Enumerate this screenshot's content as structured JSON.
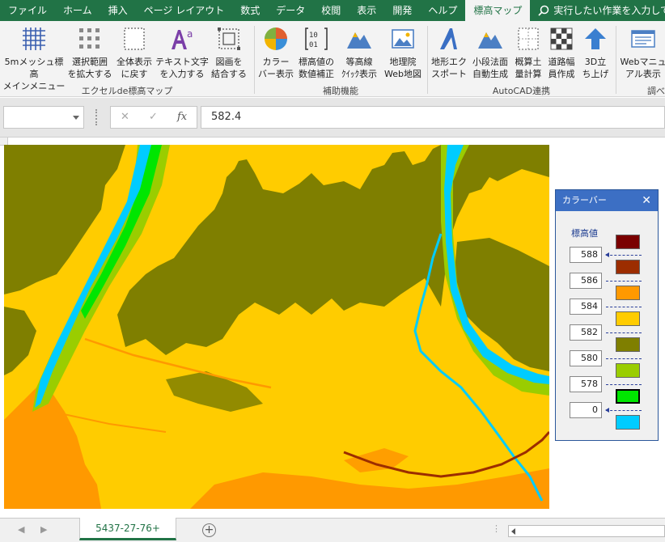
{
  "tabs": [
    "ファイル",
    "ホーム",
    "挿入",
    "ページ レイアウト",
    "数式",
    "データ",
    "校閲",
    "表示",
    "開発",
    "ヘルプ",
    "標高マップ"
  ],
  "tell_me": "実行したい作業を入力して",
  "ribbon": {
    "buttons": {
      "mesh_menu": "5mメッシュ標高\nメインメニュー",
      "expand_sel": "選択範囲\nを拡大する",
      "show_all": "全体表示\nに戻す",
      "text_input": "テキスト文字\nを入力する",
      "merge_figure": "図画を\n結合する",
      "colorbar": "カラー\nバー表示",
      "value_correct": "標高値の\n数値補正",
      "contour": "等高線\nｸｲｯｸ表示",
      "gsi_map": "地理院\nWeb地図",
      "terrain_export": "地形エク\nスポート",
      "small_section": "小段法面\n自動生成",
      "rough_calc": "概算土\n量計算",
      "road_width": "道路幅\n員作成",
      "lift3d": "3D立\nち上げ",
      "web_manual": "Webマニュ\nアル表示"
    },
    "groups": {
      "excel_map": "エクセルde標高マップ",
      "aux": "補助機能",
      "autocad": "AutoCAD連携",
      "research": "調べ"
    }
  },
  "formula_bar": {
    "name_box": "",
    "cancel": "✕",
    "enter": "✓",
    "fx": "fx",
    "value": "582.4"
  },
  "colorbar": {
    "title": "カラーバー",
    "close": "✕",
    "header": "標高値",
    "values": [
      "588",
      "586",
      "584",
      "582",
      "580",
      "578",
      "0"
    ],
    "swatches": [
      "#7a0000",
      "#9c2d00",
      "#ff9900",
      "#ffcc00",
      "#7f7f00",
      "#9acd00",
      "#00e600",
      "#00ccff"
    ],
    "selected_index": 6
  },
  "map_colors": {
    "base": "#ffcc00",
    "low": "#7f7f00",
    "high": "#ff9900",
    "water": "#00ccff",
    "bank": "#9acd00",
    "bright": "#00e600",
    "ridge": "#9c2d00"
  },
  "sheet_tab": "5437-27-76+"
}
